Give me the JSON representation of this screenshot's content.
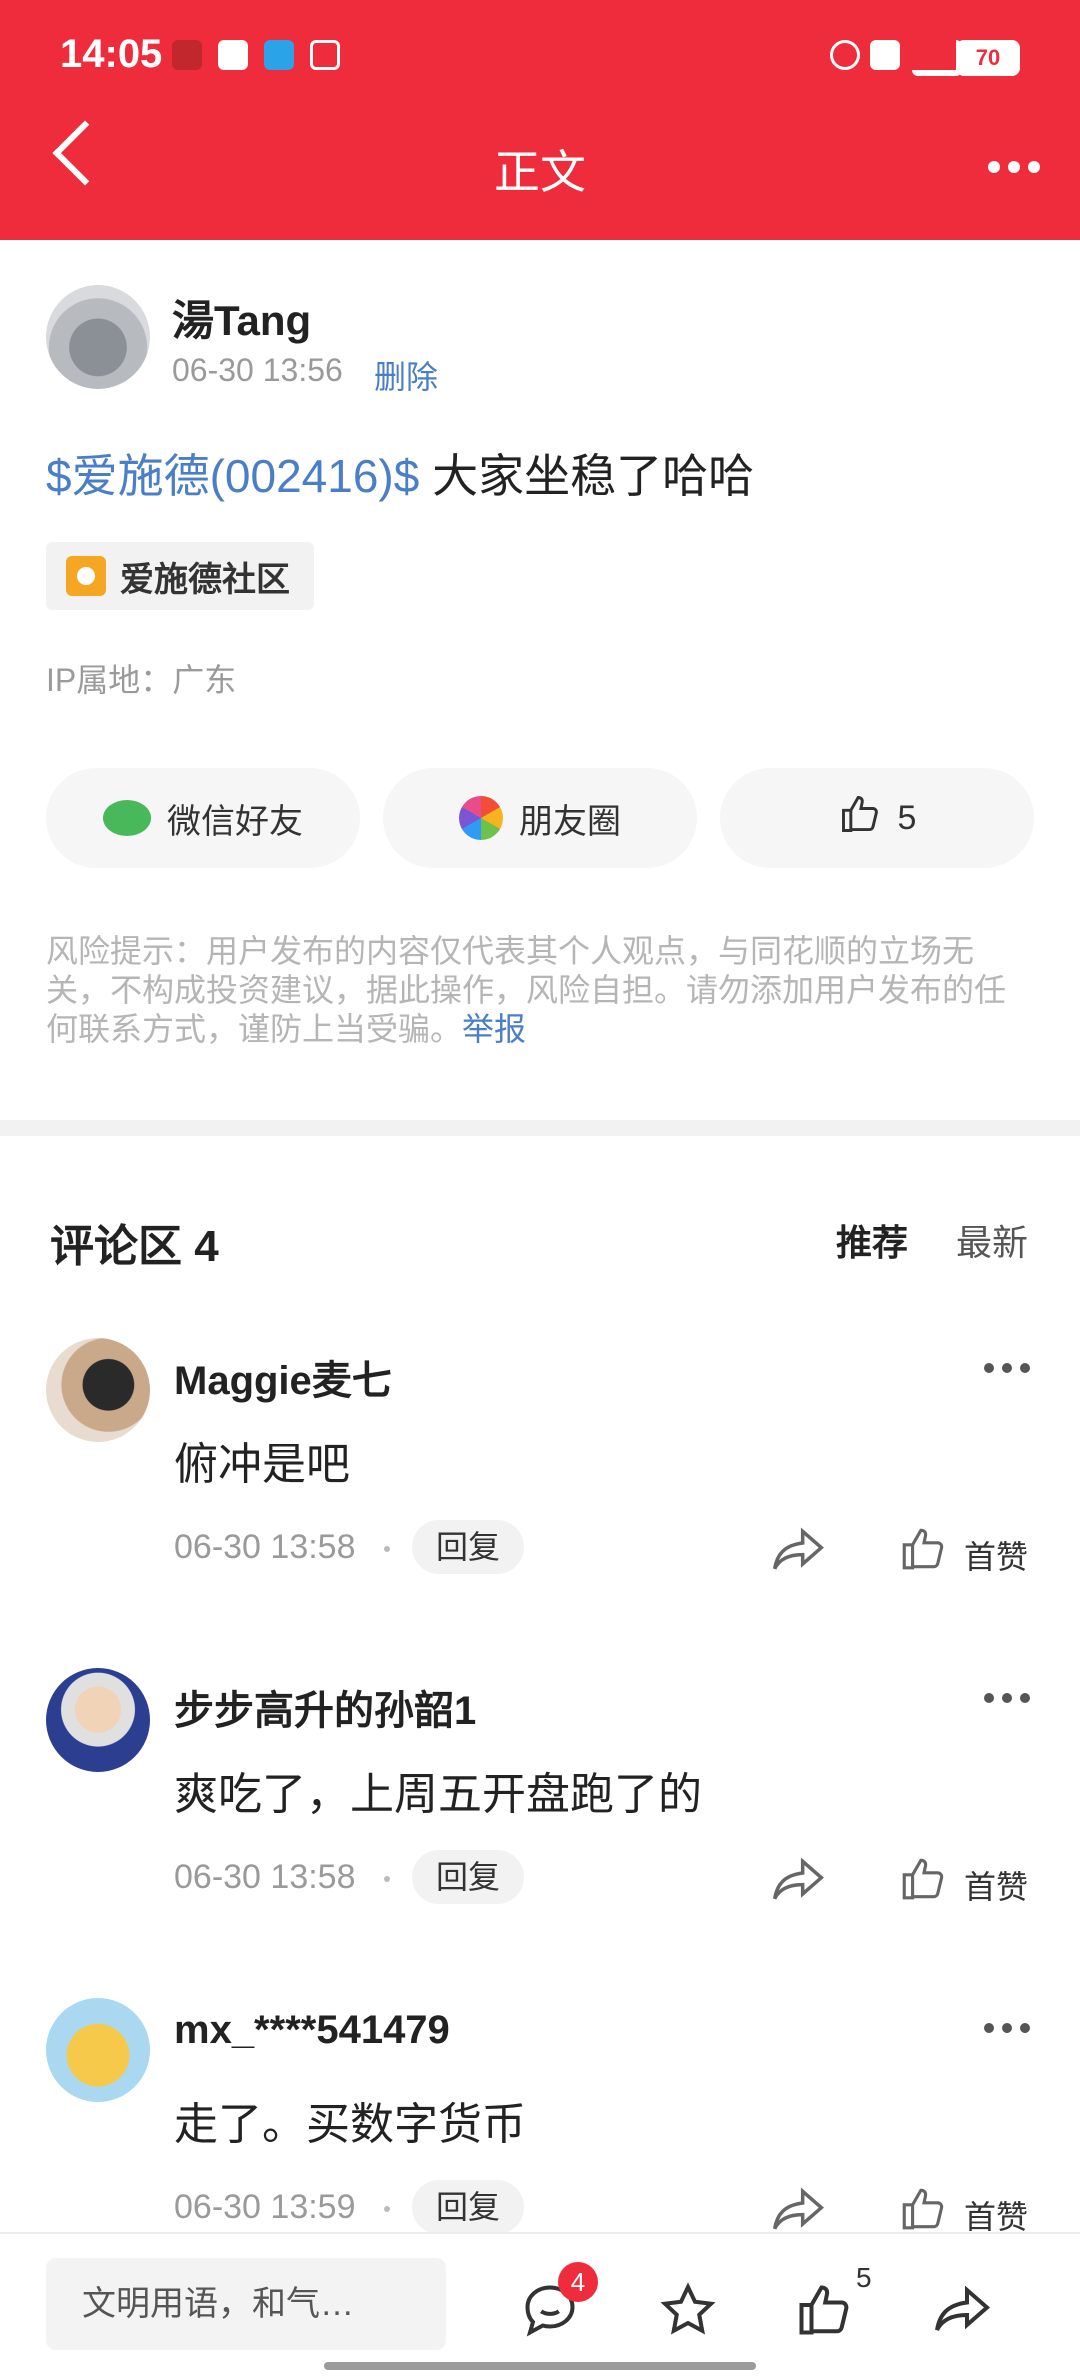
{
  "status_bar": {
    "time": "14:05",
    "battery": "70"
  },
  "header": {
    "title": "正文"
  },
  "post": {
    "author": "湯Tang",
    "time": "06-30 13:56",
    "delete_label": "删除",
    "stock_tag": "$爱施德(002416)$",
    "body_text": " 大家坐稳了哈哈",
    "community": "爱施德社区",
    "ip_location": "IP属地：广东"
  },
  "share": {
    "wechat_label": "微信好友",
    "moments_label": "朋友圈",
    "like_count": "5"
  },
  "risk_notice": {
    "text": "风险提示：用户发布的内容仅代表其个人观点，与同花顺的立场无关，不构成投资建议，据此操作，风险自担。请勿添加用户发布的任何联系方式，谨防上当受骗。",
    "report_link": "举报"
  },
  "comments_section": {
    "title": "评论区 4",
    "sort_recommended": "推荐",
    "sort_latest": "最新",
    "items": [
      {
        "name": "Maggie麦七",
        "text": "俯冲是吧",
        "time": "06-30 13:58",
        "reply": "回复",
        "first_like": "首赞"
      },
      {
        "name": "步步高升的孙韶1",
        "text": "爽吃了，上周五开盘跑了的",
        "time": "06-30 13:58",
        "reply": "回复",
        "first_like": "首赞"
      },
      {
        "name": "mx_****541479",
        "text": "走了。买数字货币",
        "time": "06-30 13:59",
        "reply": "回复",
        "first_like": "首赞"
      }
    ]
  },
  "bottom_bar": {
    "input_placeholder": "文明用语，和气…",
    "comment_badge": "4",
    "like_count": "5"
  },
  "colors": {
    "brand_red": "#ef2c3b",
    "link_blue": "#4a7fc7"
  }
}
